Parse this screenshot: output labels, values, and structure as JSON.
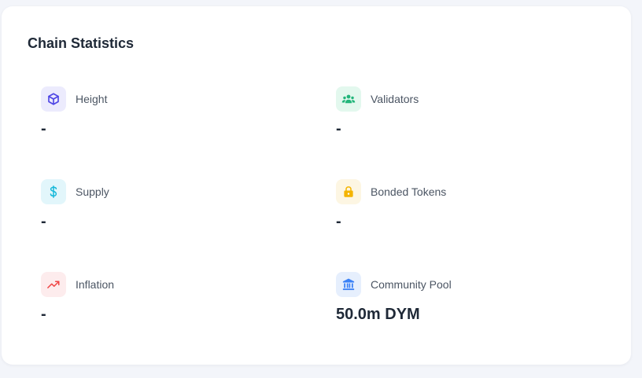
{
  "card": {
    "title": "Chain Statistics"
  },
  "stats": [
    {
      "label": "Height",
      "value": "-",
      "icon": "cube-icon",
      "icon_bg": "#ecebfd",
      "icon_color": "#4f46e5"
    },
    {
      "label": "Validators",
      "value": "-",
      "icon": "users-icon",
      "icon_bg": "#e3f8ee",
      "icon_color": "#22b57a"
    },
    {
      "label": "Supply",
      "value": "-",
      "icon": "dollar-icon",
      "icon_bg": "#e2f6fb",
      "icon_color": "#14b8d9"
    },
    {
      "label": "Bonded Tokens",
      "value": "-",
      "icon": "lock-icon",
      "icon_bg": "#fdf6e3",
      "icon_color": "#f4b400"
    },
    {
      "label": "Inflation",
      "value": "-",
      "icon": "trending-up-icon",
      "icon_bg": "#fdeced",
      "icon_color": "#ef4444"
    },
    {
      "label": "Community Pool",
      "value": "50.0m DYM",
      "icon": "bank-icon",
      "icon_bg": "#e6effd",
      "icon_color": "#3b82f6"
    }
  ]
}
